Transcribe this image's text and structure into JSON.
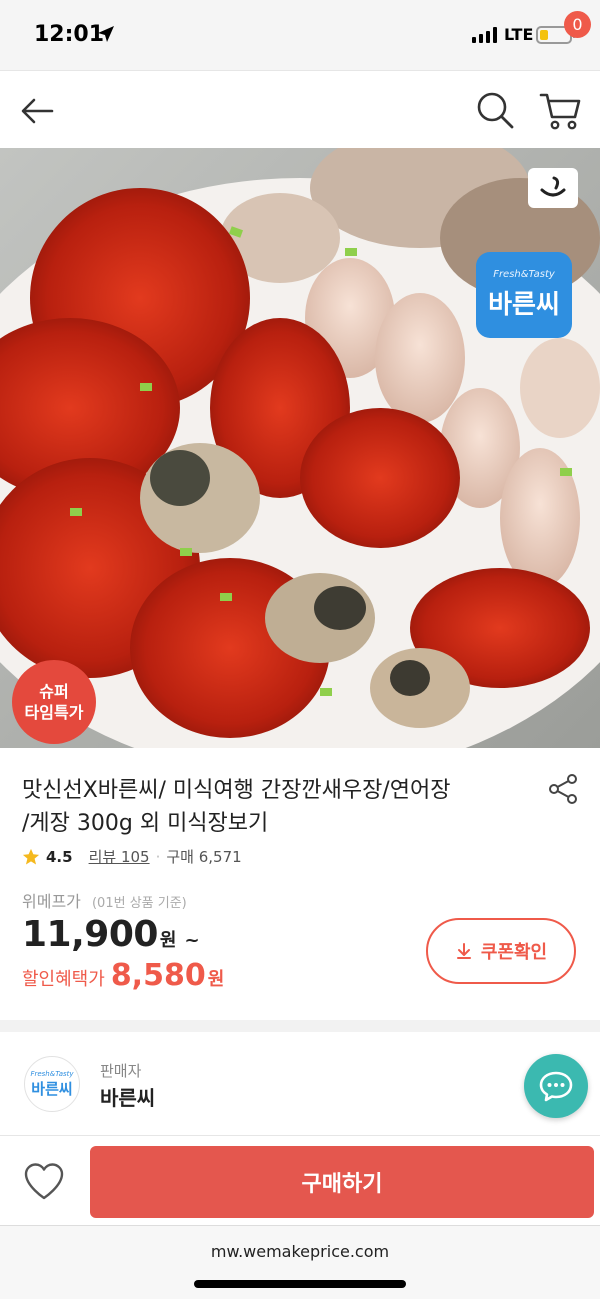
{
  "status_bar": {
    "time": "12:01",
    "network": "LTE"
  },
  "header": {
    "cart_count": "0"
  },
  "product_image": {
    "super_badge_line1": "슈퍼",
    "super_badge_line2": "타임특가",
    "brand_small": "Fresh&Tasty",
    "brand_big": "바른씨"
  },
  "product": {
    "title_line1": "맛신선X바른씨/ 미식여행 간장깐새우장/연어장",
    "title_line2": "/게장 300g 외 미식장보기",
    "rating": "4.5",
    "review_label": "리뷰 105",
    "purchase_label": "구매 6,571",
    "price_label": "위메프가",
    "price_sub": "(01번 상품 기준)",
    "price": "11,900",
    "price_unit": "원",
    "price_tilde": "~",
    "discount_label": "할인혜택가",
    "discount_price": "8,580",
    "discount_unit": "원",
    "coupon_label": "쿠폰확인"
  },
  "seller": {
    "label": "판매자",
    "name": "바른씨",
    "logo_small": "Fresh&Tasty",
    "logo_big": "바른씨"
  },
  "bottom_bar": {
    "buy_label": "구매하기"
  },
  "browser": {
    "url": "mw.wemakeprice.com"
  },
  "colors": {
    "accent": "#ef5a4a",
    "buy_button": "#e4574e",
    "chat_button": "#3bb9b0",
    "brand_blue": "#2f8fe0",
    "star": "#f5b91e"
  }
}
